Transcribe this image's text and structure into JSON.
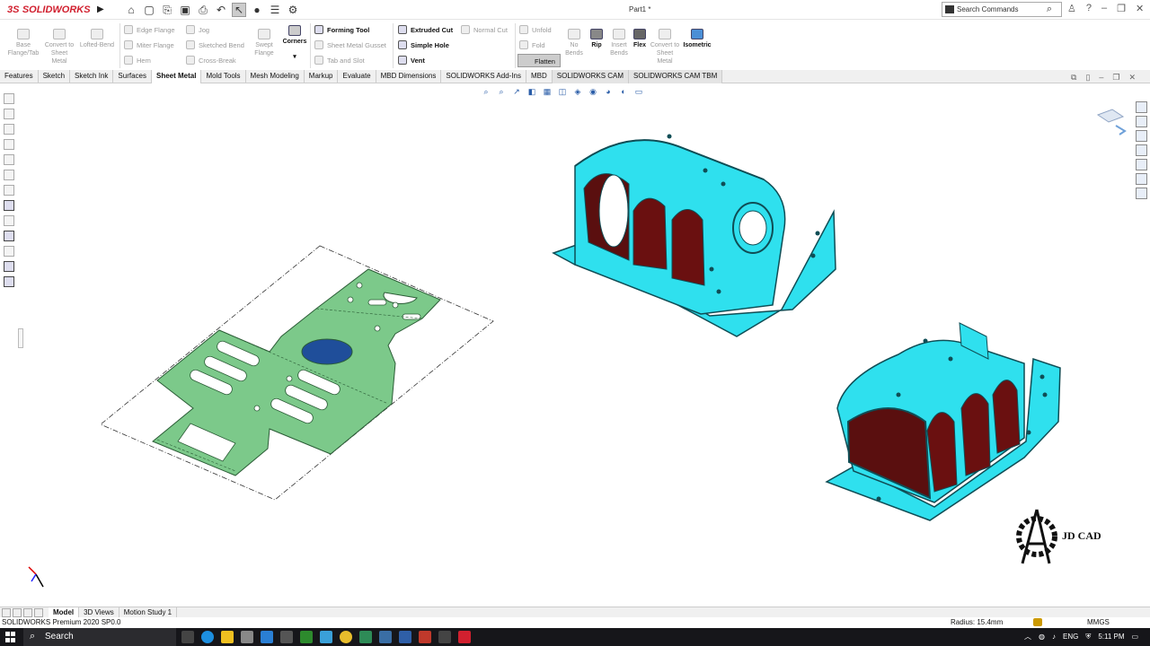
{
  "app": {
    "brand_mark": "3S",
    "brand": "SOLIDWORKS",
    "document_title": "Part1 *"
  },
  "search": {
    "placeholder": "Search Commands"
  },
  "toolbar": {
    "icons": [
      "home-icon",
      "new-icon",
      "open-icon",
      "save-icon",
      "print-icon",
      "undo-icon",
      "select-icon",
      "rebuild-icon",
      "file-properties-icon",
      "options-icon"
    ]
  },
  "ribbon": {
    "base_flange": "Base Flange/Tab",
    "convert_sheet": "Convert to Sheet Metal",
    "lofted_bend": "Lofted-Bend",
    "edge_flange": "Edge Flange",
    "miter_flange": "Miter Flange",
    "hem": "Hem",
    "jog": "Jog",
    "sketched_bend": "Sketched Bend",
    "cross_break": "Cross-Break",
    "swept_flange": "Swept Flange",
    "corners": "Corners",
    "forming_tool": "Forming Tool",
    "gusset": "Sheet Metal Gusset",
    "tab_slot": "Tab and Slot",
    "extruded_cut": "Extruded Cut",
    "simple_hole": "Simple Hole",
    "vent": "Vent",
    "normal_cut": "Normal Cut",
    "unfold": "Unfold",
    "fold": "Fold",
    "flatten": "Flatten",
    "no_bends": "No Bends",
    "rip": "Rip",
    "insert_bends": "Insert Bends",
    "flex": "Flex",
    "convert_sheet2": "Convert to Sheet Metal",
    "isometric": "Isometric"
  },
  "tabs": [
    "Features",
    "Sketch",
    "Sketch Ink",
    "Surfaces",
    "Sheet Metal",
    "Mold Tools",
    "Mesh Modeling",
    "Markup",
    "Evaluate",
    "MBD Dimensions",
    "SOLIDWORKS Add-Ins",
    "MBD",
    "SOLIDWORKS CAM",
    "SOLIDWORKS CAM TBM"
  ],
  "active_tab": "Sheet Metal",
  "bottom_tabs": [
    "Model",
    "3D Views",
    "Motion Study 1"
  ],
  "status": {
    "product": "SOLIDWORKS Premium 2020 SP0.0",
    "radius": "Radius: 15.4mm",
    "units": "MMGS"
  },
  "watermark": {
    "text": "JD CAD"
  },
  "taskbar": {
    "search": "Search",
    "lang": "ENG",
    "time": "5:11 PM"
  },
  "colors": {
    "part_blue": "#2fe0ee",
    "flat_green": "#7cc98a",
    "brand_red": "#d1202f"
  }
}
